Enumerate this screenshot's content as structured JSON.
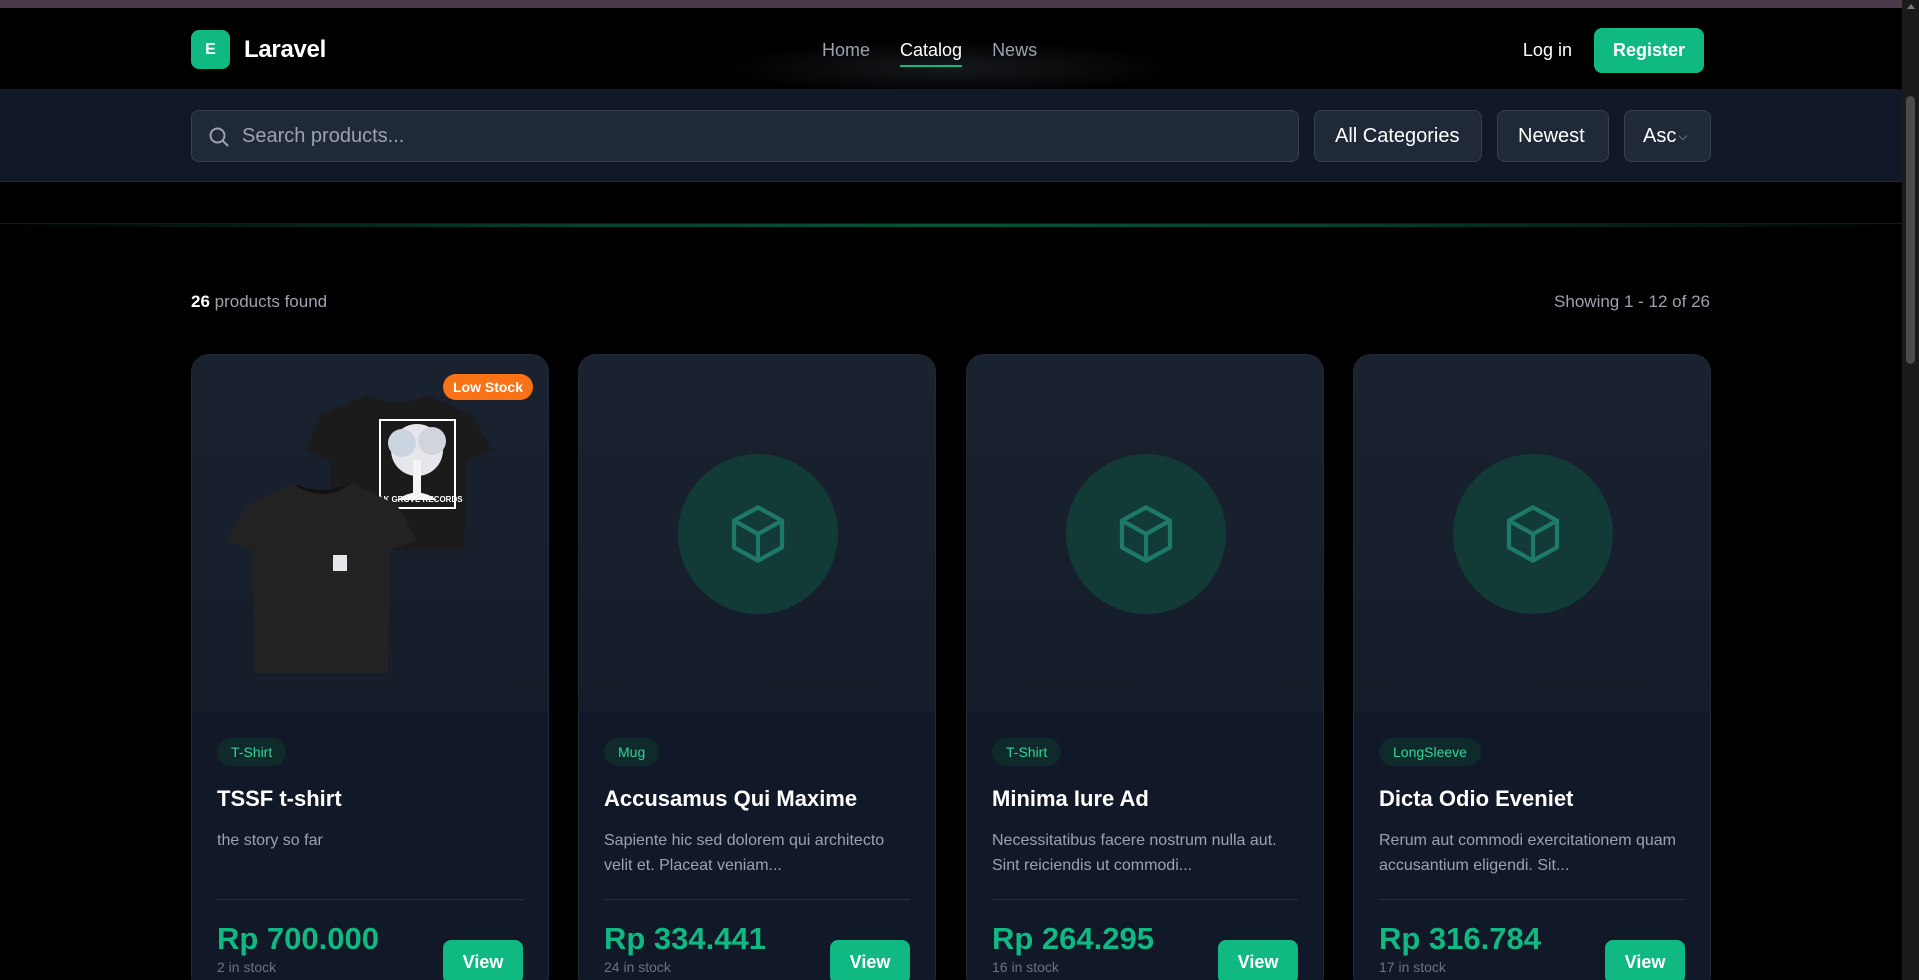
{
  "header": {
    "logo_letter": "E",
    "app_name": "Laravel",
    "nav": [
      {
        "label": "Home",
        "active": false
      },
      {
        "label": "Catalog",
        "active": true
      },
      {
        "label": "News",
        "active": false
      }
    ],
    "login_label": "Log in",
    "register_label": "Register"
  },
  "filters": {
    "search_placeholder": "Search products...",
    "category": "All Categories",
    "sort": "Newest",
    "order": "Asc"
  },
  "results": {
    "count": "26",
    "count_suffix": " products found",
    "showing": "Showing 1 - 12 of 26"
  },
  "products": [
    {
      "badge": "Low Stock",
      "category": "T-Shirt",
      "name": "TSSF t-shirt",
      "description": "the story so far",
      "price": "Rp 700.000",
      "stock": "2 in stock",
      "view_label": "View",
      "image": "tshirt",
      "print_text": "OAK GROVE RECORDS"
    },
    {
      "badge": "",
      "category": "Mug",
      "name": "Accusamus Qui Maxime",
      "description": "Sapiente hic sed dolorem qui architecto velit et. Placeat veniam...",
      "price": "Rp 334.441",
      "stock": "24 in stock",
      "view_label": "View",
      "image": "cube-icon"
    },
    {
      "badge": "",
      "category": "T-Shirt",
      "name": "Minima Iure Ad",
      "description": "Necessitatibus facere nostrum nulla aut. Sint reiciendis ut commodi...",
      "price": "Rp 264.295",
      "stock": "16 in stock",
      "view_label": "View",
      "image": "cube-icon"
    },
    {
      "badge": "",
      "category": "LongSleeve",
      "name": "Dicta Odio Eveniet",
      "description": "Rerum aut commodi exercitationem quam accusantium eligendi. Sit...",
      "price": "Rp 316.784",
      "stock": "17 in stock",
      "view_label": "View",
      "image": "cube-icon"
    }
  ],
  "colors": {
    "accent": "#10b981",
    "badge_low": "#f97316",
    "card_bg": "#111827"
  }
}
